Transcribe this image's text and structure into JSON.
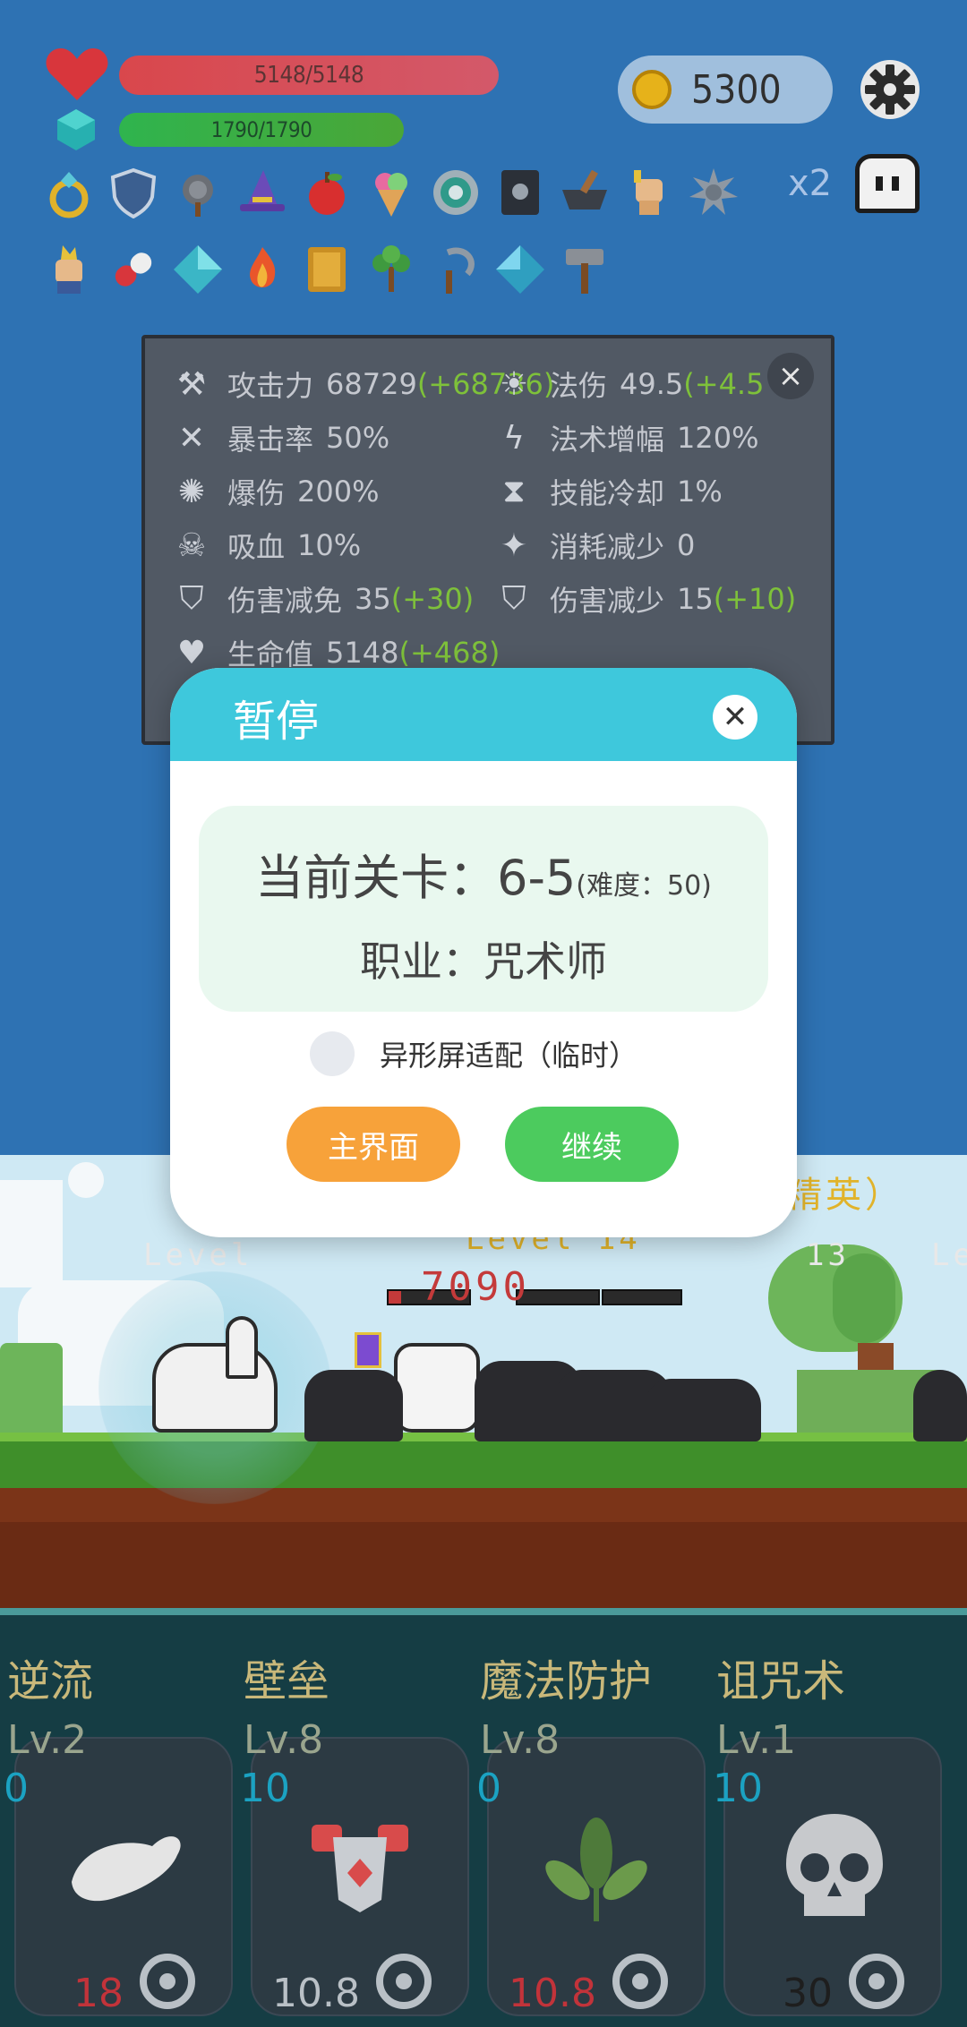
{
  "hud": {
    "hp_text": "5148/5148",
    "mp_text": "1790/1790",
    "hp_fill": 1.0,
    "mp_fill": 1.0,
    "coins": "5300",
    "speed_multiplier": "x2",
    "icons": {
      "heart": "heart-icon",
      "gem": "mana-gem-icon",
      "coin": "coin-icon",
      "settings": "gear-icon",
      "ghost": "ghost-icon"
    },
    "inventory_row1": [
      "ring",
      "shield",
      "mace",
      "wizard-hat",
      "apple",
      "ice-cream",
      "target-orb",
      "dark-book",
      "mortar",
      "fist",
      "spiked-ball"
    ],
    "inventory_row2": [
      "torch-fist",
      "pill",
      "diamond",
      "flame",
      "golden-book",
      "sapling",
      "sickle",
      "blue-diamond",
      "hammer"
    ]
  },
  "stats": {
    "attack": {
      "label": "攻击力",
      "value": "68729",
      "bonus": "(+68736)"
    },
    "magic_damage": {
      "label": "法伤",
      "value": "49.5",
      "bonus": "(+4.5"
    },
    "crit_rate": {
      "label": "暴击率",
      "value": "50%"
    },
    "spell_amp": {
      "label": "法术增幅",
      "value": "120%"
    },
    "crit_damage": {
      "label": "爆伤",
      "value": "200%"
    },
    "cooldown": {
      "label": "技能冷却",
      "value": "1%"
    },
    "lifesteal": {
      "label": "吸血",
      "value": "10%"
    },
    "cost_reduction": {
      "label": "消耗减少",
      "value": "0"
    },
    "damage_immunity": {
      "label": "伤害减免",
      "value": "35",
      "bonus": "(+30)"
    },
    "damage_reduction": {
      "label": "伤害减少",
      "value": "15",
      "bonus": "(+10)"
    },
    "hp": {
      "label": "生命值",
      "value": "5148",
      "bonus": "(+468)"
    }
  },
  "scene": {
    "elite_label": "精英）",
    "level_text_left": "Level",
    "level_text_mid": "Level 14",
    "level_text_right": "Le",
    "level_num": "13",
    "damage_number": "7090"
  },
  "skills": [
    {
      "name": "逆流",
      "level": "Lv.2",
      "cost": "0",
      "cooldown": "18",
      "cd_color": "#c2333a",
      "icon": "wing-icon"
    },
    {
      "name": "壁垒",
      "level": "Lv.8",
      "cost": "10",
      "cooldown": "10.8",
      "cd_color": "#b9c0c6",
      "icon": "armor-icon"
    },
    {
      "name": "魔法防护",
      "level": "Lv.8",
      "cost": "0",
      "cooldown": "10.8",
      "cd_color": "#c2333a",
      "icon": "leaf-icon"
    },
    {
      "name": "诅咒术",
      "level": "Lv.1",
      "cost": "10",
      "cooldown": "30",
      "cd_color": "#1e1e1e",
      "icon": "skull-icon"
    }
  ],
  "pause": {
    "title": "暂停",
    "stage_label": "当前关卡：",
    "stage_value": "6-5",
    "difficulty": "(难度：50)",
    "job": "职业：咒术师",
    "toggle_label": "异形屏适配（临时）",
    "home_button": "主界面",
    "continue_button": "继续"
  }
}
